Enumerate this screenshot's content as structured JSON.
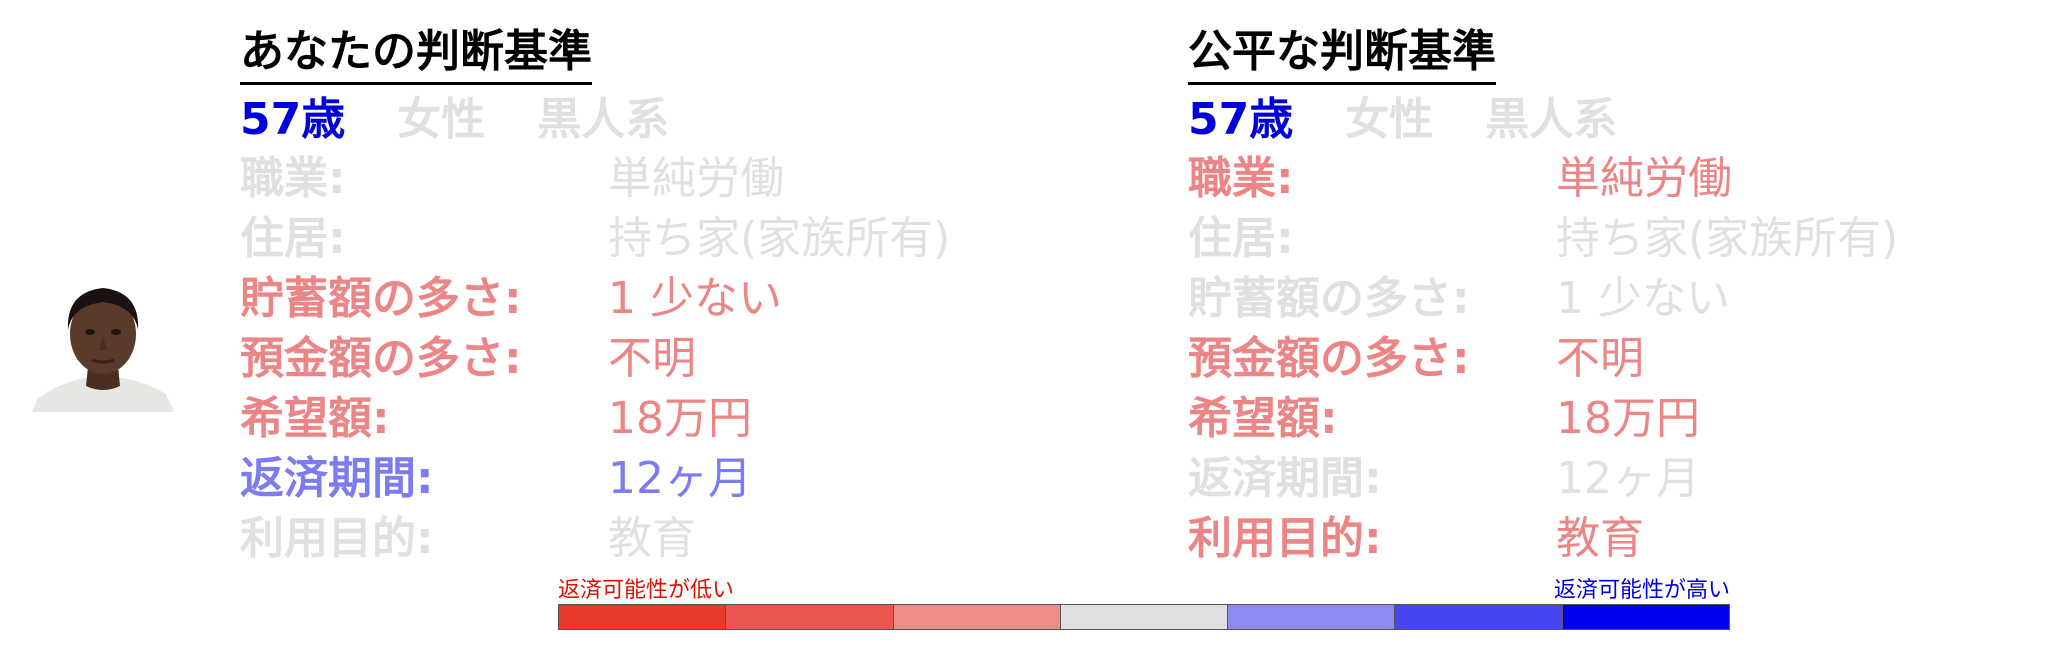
{
  "photo": {
    "icon": "person-portrait"
  },
  "left_panel": {
    "title": "あなたの判断基準",
    "demographics": [
      {
        "text": "57歳",
        "color": "#0000dd"
      },
      {
        "text": "女性",
        "color": "#e0e0e0"
      },
      {
        "text": "黒人系",
        "color": "#e0e0e0"
      }
    ],
    "attributes": [
      {
        "label": "職業:",
        "value": "単純労働",
        "color": "#e0e0e0"
      },
      {
        "label": "住居:",
        "value": "持ち家(家族所有)",
        "color": "#e0e0e0"
      },
      {
        "label": "貯蓄額の多さ:",
        "value": "1 少ない",
        "color": "#ec8585"
      },
      {
        "label": "預金額の多さ:",
        "value": "不明",
        "color": "#ec8585"
      },
      {
        "label": "希望額:",
        "value": "18万円",
        "color": "#ec8585"
      },
      {
        "label": "返済期間:",
        "value": "12ヶ月",
        "color": "#7c7cf0"
      },
      {
        "label": "利用目的:",
        "value": "教育",
        "color": "#e0e0e0"
      }
    ]
  },
  "right_panel": {
    "title": "公平な判断基準",
    "demographics": [
      {
        "text": "57歳",
        "color": "#0000dd"
      },
      {
        "text": "女性",
        "color": "#e0e0e0"
      },
      {
        "text": "黒人系",
        "color": "#e0e0e0"
      }
    ],
    "attributes": [
      {
        "label": "職業:",
        "value": "単純労働",
        "color": "#ec8585"
      },
      {
        "label": "住居:",
        "value": "持ち家(家族所有)",
        "color": "#e0e0e0"
      },
      {
        "label": "貯蓄額の多さ:",
        "value": "1 少ない",
        "color": "#e0e0e0"
      },
      {
        "label": "預金額の多さ:",
        "value": "不明",
        "color": "#ec8585"
      },
      {
        "label": "希望額:",
        "value": "18万円",
        "color": "#ec8585"
      },
      {
        "label": "返済期間:",
        "value": "12ヶ月",
        "color": "#e0e0e0"
      },
      {
        "label": "利用目的:",
        "value": "教育",
        "color": "#ec8585"
      }
    ]
  },
  "scale": {
    "low_label": "返済可能性が低い",
    "high_label": "返済可能性が高い",
    "low_color": "#dd1100",
    "high_color": "#0000dd",
    "segments": [
      "#e83a2a",
      "#ea5550",
      "#ee8c88",
      "#e0e0e0",
      "#8b8bf0",
      "#4646f0",
      "#0000ee"
    ]
  }
}
